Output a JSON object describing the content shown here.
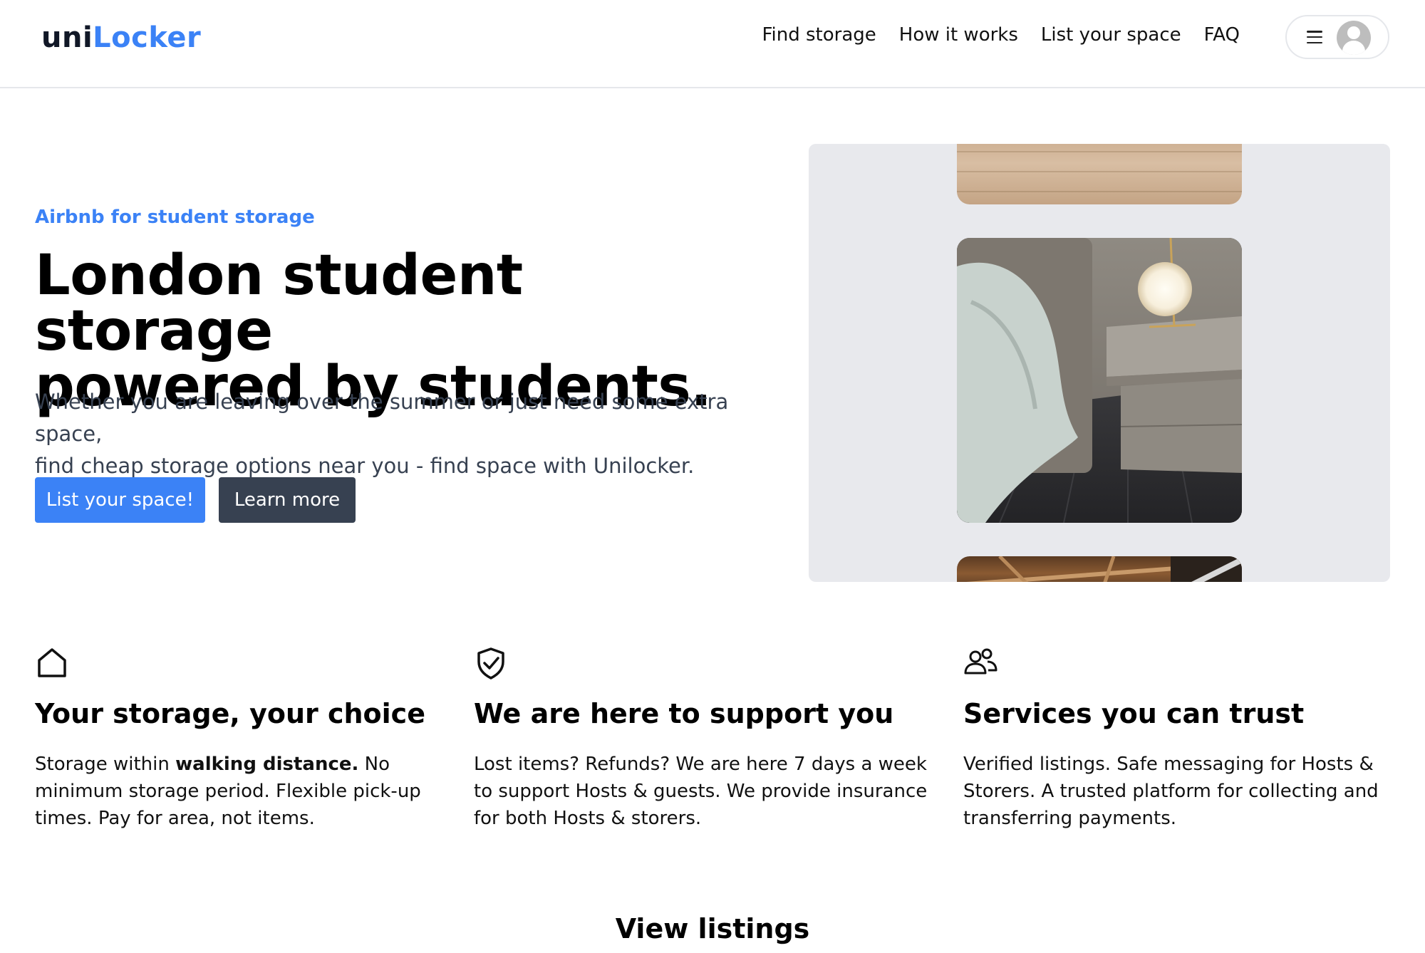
{
  "brand": {
    "logo_part1": "uni",
    "logo_part2": "Locker",
    "accent": "#3b82f6"
  },
  "nav": {
    "items": [
      {
        "label": "Find storage"
      },
      {
        "label": "How it works"
      },
      {
        "label": "List your space"
      },
      {
        "label": "FAQ"
      }
    ]
  },
  "user_menu": {
    "menu_icon": "hamburger-icon",
    "avatar_icon": "user-avatar-icon"
  },
  "hero": {
    "eyebrow": "Airbnb for student storage",
    "title_line1": "London student storage",
    "title_line2": "powered by students.",
    "subtitle_line1": "Whether you are leaving over the summer or just need some extra space,",
    "subtitle_line2": "find cheap storage options near you - find space with Unilocker.",
    "primary_button": "List your space!",
    "secondary_button": "Learn more",
    "primary_color": "#3b82f6",
    "secondary_color": "#374151"
  },
  "features": [
    {
      "icon": "home-icon",
      "title": "Your storage, your choice",
      "text_pre": "Storage within ",
      "text_bold": "walking distance.",
      "text_post": " No minimum storage period. Flexible pick-up times. Pay for area, not items."
    },
    {
      "icon": "shield-check-icon",
      "title": "We are here to support you",
      "text": "Lost items? Refunds? We are here 7 days a week to support Hosts & guests. We provide insurance for both Hosts & storers."
    },
    {
      "icon": "users-icon",
      "title": "Services you can trust",
      "text": "Verified listings. Safe messaging for Hosts & Storers. A trusted platform for collecting and transferring payments."
    }
  ],
  "listings": {
    "title": "View listings"
  }
}
